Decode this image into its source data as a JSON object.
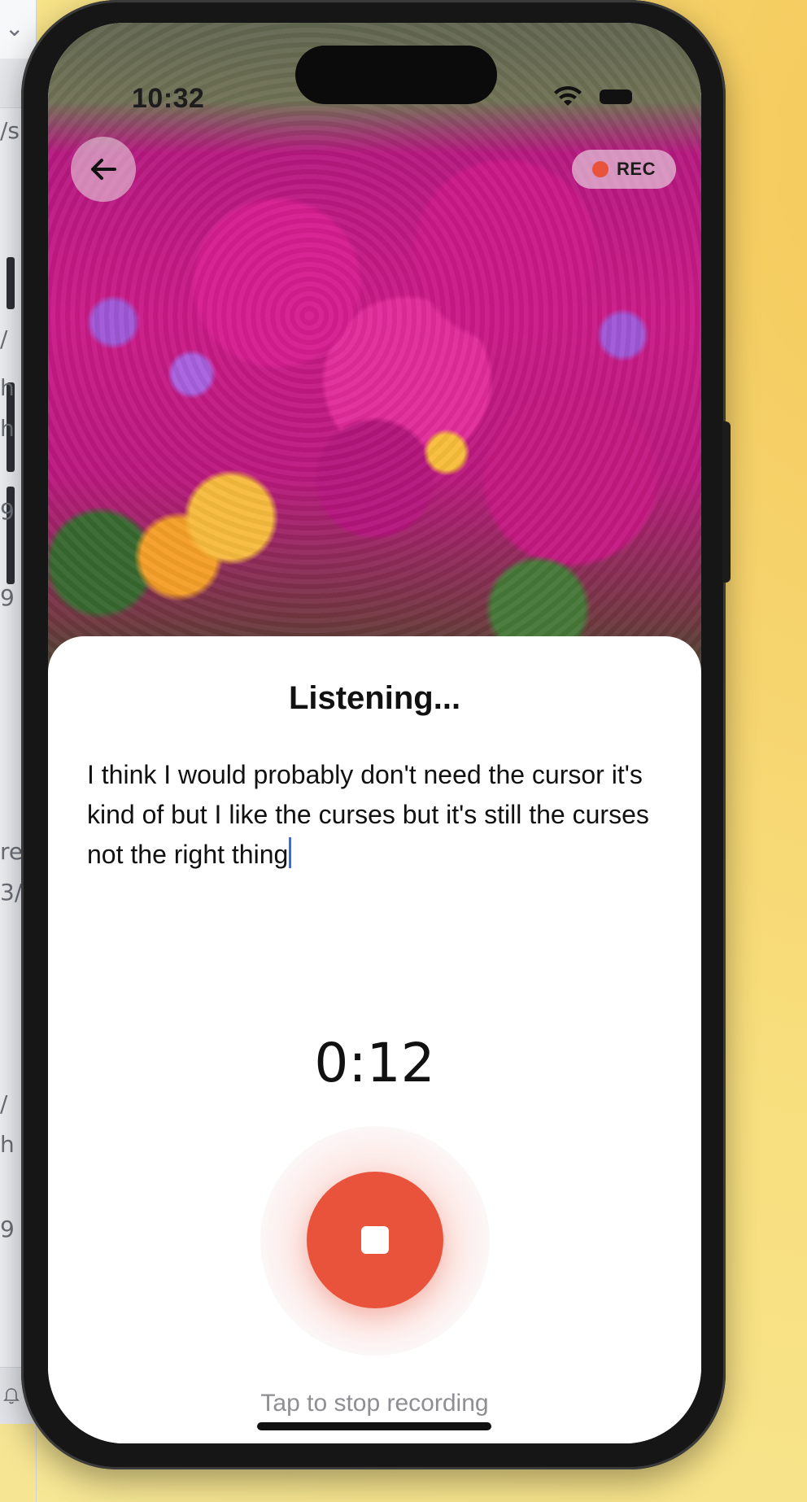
{
  "background_window": {
    "fragments": [
      "⌄",
      "/s",
      "/",
      "h",
      "h",
      "9 -",
      "9 -",
      "re",
      "3/",
      "/",
      "h",
      "9 -"
    ]
  },
  "status_bar": {
    "time": "10:32"
  },
  "header": {
    "rec_label": "REC"
  },
  "sheet": {
    "title": "Listening...",
    "transcript": "I think I would probably don't need the cursor it's kind of but I like the curses but it's still the curses not the right thing",
    "timer": "0:12",
    "hint": "Tap to stop recording"
  },
  "colors": {
    "accent_red": "#e9533b",
    "caret_blue": "#2f6fe8"
  },
  "icons": {
    "back": "arrow-left-icon",
    "stop": "stop-icon",
    "record": "record-dot-icon"
  }
}
